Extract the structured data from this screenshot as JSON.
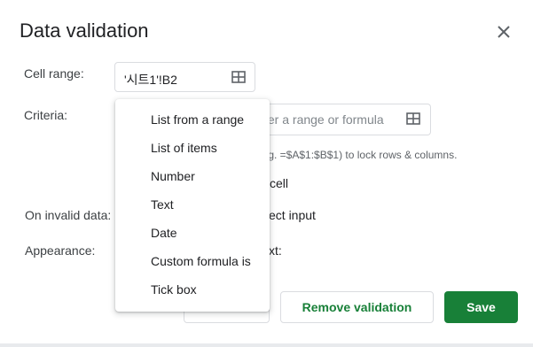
{
  "dialog": {
    "title": "Data validation",
    "close_icon": "close-icon"
  },
  "cell_range": {
    "label": "Cell range:",
    "value": "'시트1'!B2",
    "icon": "grid-icon"
  },
  "criteria": {
    "label": "Criteria:",
    "placeholder_visible": "ter a range or formula",
    "icon": "grid-icon",
    "hint_visible": ".g. =$A$1:$B$1) to lock rows & columns.",
    "option_fragment": "cell"
  },
  "on_invalid": {
    "label": "On invalid data:",
    "fragment": "ect input"
  },
  "appearance": {
    "label": "Appearance:",
    "fragment": "xt:"
  },
  "dropdown": {
    "items": [
      "List from a range",
      "List of items",
      "Number",
      "Text",
      "Date",
      "Custom formula is",
      "Tick box"
    ]
  },
  "buttons": {
    "remove": "Remove validation",
    "save": "Save"
  },
  "colors": {
    "accent": "#188038",
    "border": "#dadce0",
    "text": "#202124"
  }
}
